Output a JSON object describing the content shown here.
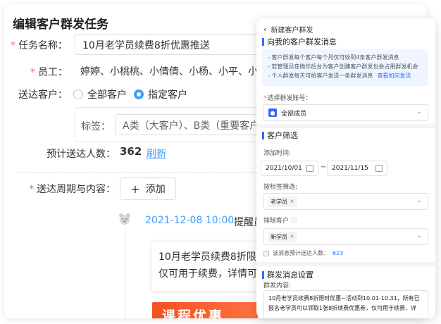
{
  "main": {
    "title": "编辑客户群发任务",
    "task_name_label": "任务名称：",
    "task_name_value": "10月老学员续费8折优惠推送",
    "staff_label": "员工：",
    "staff_value": "婷婷、小桃桃、小倩倩、小杨、小平、小",
    "recipients_label": "送达客户：",
    "radio_all": "全部客户",
    "radio_specified": "指定客户",
    "tag_label": "标签：",
    "tag_value": "A类（大客户）、B类（重要客户",
    "estimate_label": "预计送达人数：",
    "estimate_value": "362",
    "refresh_link": "刷新",
    "period_label": "送达周期与内容：",
    "add_button": "添加",
    "schedule_time": "2021-12-08 10:00",
    "schedule_remind": "提醒员",
    "message_line1": "10月老学员续费8折限时",
    "message_line2": "仅可用于续费，详情可",
    "banner_text": "课程优惠"
  },
  "phone": {
    "back_title": "新建客户群发",
    "section1_title": "向我的客户群发消息",
    "notice_line1": "- 客户群发每个客户每个月仅可收到4条客户群发消息",
    "notice_line2": "- 若管理员在微伴后台为客户创建客户群发也会占用群发机会",
    "notice_line3": "- 个人群发每天可给客户发送一条群发消息",
    "notice_link": "查看如何发送",
    "account_label": "选择群发账号：",
    "account_value": "全部成员",
    "section2_title": "客户筛选",
    "add_time_label": "添加时间:",
    "date_start": "2021/10/01",
    "date_end": "2021/11/15",
    "tag_filter_label": "按标签筛选:",
    "tag_chip": "老学员",
    "exclude_label": "排除客户",
    "exclude_chip": "新学员",
    "estimate_text": "该消息预计送达人数：",
    "estimate_num": "623",
    "section3_title": "群发消息设置",
    "content_label": "群发内容:",
    "content_line1": "10月老学员续费8折限时优惠~活动到10.01-10.31，所有已",
    "content_line2": "报名老学员可以领取1张8折续费优惠券，仅可用于续费，详"
  },
  "colors": {
    "accent": "#409eff",
    "phone_accent": "#2f6bff",
    "required": "#f56c6c",
    "banner": "#f4511e"
  }
}
